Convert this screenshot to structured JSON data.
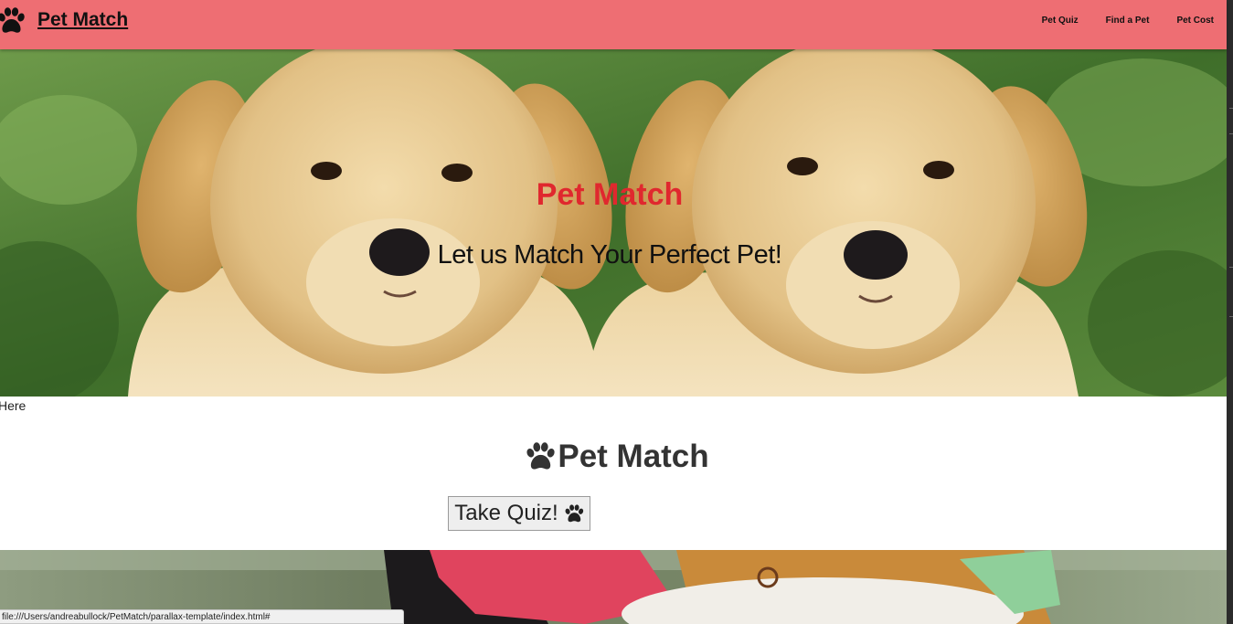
{
  "colors": {
    "nav_background": "#ee6e73",
    "hero_title": "#e0282e",
    "grass": "#4f7d35",
    "puppy_fur": "#e8c98f"
  },
  "navbar": {
    "brand_icon": "paw-icon",
    "brand_label": "Pet Match",
    "links": [
      {
        "label": "Pet Quiz"
      },
      {
        "label": "Find a Pet"
      },
      {
        "label": "Pet Cost"
      }
    ]
  },
  "hero": {
    "image": "two golden retriever puppies on grass",
    "title": "Pet Match",
    "subtitle": "Let us Match Your Perfect Pet!"
  },
  "main": {
    "stray_text": "Here",
    "section_title_icon": "paw-icon",
    "section_title": "Pet Match",
    "quiz_button_label": "Take Quiz!",
    "quiz_button_icon": "paw-icon"
  },
  "second_parallax": {
    "image": "dogs wearing bandanas outdoors"
  },
  "status_bar": {
    "url": "file:///Users/andreabullock/PetMatch/parallax-template/index.html#"
  }
}
